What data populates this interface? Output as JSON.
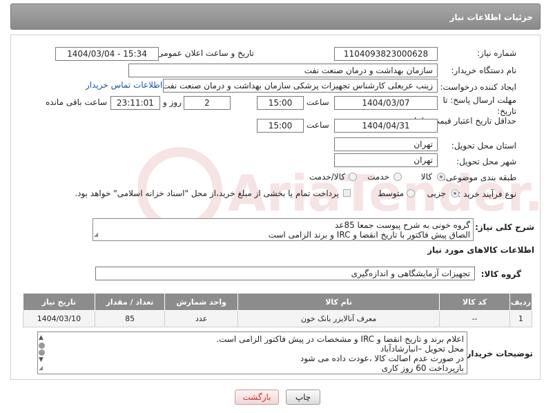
{
  "header": {
    "title": "جزئیات اطلاعات نیاز"
  },
  "fields": {
    "need_number_label": "شماره نیاز:",
    "need_number_value": "1104093823000628",
    "announce_label": "تاریخ و ساعت اعلان عمومی:",
    "announce_value": "1404/03/04 - 15:34",
    "buyer_org_label": "نام دستگاه خریدار:",
    "buyer_org_value": "سازمان بهداشت و درمان صنعت نفت",
    "creator_label": "ایجاد کننده درخواست:",
    "creator_value": "زینب عربعلی کارشناس تجهیزات پزشکی سازمان بهداشت و درمان صنعت نفت",
    "contact_link": "اطلاعات تماس خریدار",
    "deadline_label": "مهلت ارسال پاسخ: تا تاریخ:",
    "deadline_date": "1404/03/07",
    "time_label": "ساعت",
    "deadline_time": "15:00",
    "days_value": "2",
    "days_label": "روز و",
    "remaining_value": "23:11:01",
    "remaining_label": "ساعت باقی مانده",
    "price_validity_label": "حداقل تاریخ اعتبار قیمت: تا تاریخ:",
    "price_validity_date": "1404/04/31",
    "price_validity_time": "15:00",
    "province_label": "استان محل تحویل:",
    "province_value": "تهران",
    "city_label": "شهر محل تحویل:",
    "city_value": "تهران",
    "category_label": "طبقه بندی موضوعی:",
    "category_options": [
      "کالا",
      "خدمت",
      "کالا/خدمت"
    ],
    "category_selected": "کالا",
    "process_label": "نوع فرآیند خرید :",
    "process_options": [
      "جزیی",
      "متوسط"
    ],
    "process_selected": "جزیی",
    "payment_note": "پرداخت تمام یا بخشی از مبلغ خرید،از محل \"اسناد خزانه اسلامی\" خواهد بود."
  },
  "description": {
    "label": "شرح کلی نیاز:",
    "lines": [
      "گروه خونی به شرح پیوست جمعا 85عد",
      "الصاق پیش فاکتور با تاریخ انقضا و IRC  و برند الزامی است"
    ]
  },
  "goods_section": {
    "title": "اطلاعات کالاهای مورد نیاز",
    "group_label": "گروه کالا:",
    "group_value": "تجهیزات آزمایشگاهی و اندازه‌گیری"
  },
  "table": {
    "headers": [
      "ردیف",
      "کد کالا",
      "نام کالا",
      "واحد شمارش",
      "تعداد / مقدار",
      "تاریخ نیاز"
    ],
    "rows": [
      [
        "1",
        "--",
        "معرف آنالایزر بانک خون",
        "عدد",
        "85",
        "1404/03/10"
      ]
    ]
  },
  "buyer_notes": {
    "label": "توضیحات خریدار:",
    "lines": [
      "اعلام برند و تاریخ انقضا  و IRC  و مشخصات  در پیش فاکتور الزامی است.",
      "محل تحویل –انبارشادآباد",
      "در صورت عدم اصالت کالا ،عودت داده می شود",
      "بازپرداخت 60 روز کاری"
    ]
  },
  "buttons": {
    "print": "چاپ",
    "back": "بازگشت"
  },
  "watermark": {
    "text": "AriaTender.neT"
  },
  "colors": {
    "header_bg": "#999999",
    "link": "#1a55a8",
    "back_button_text": "#cc3333"
  }
}
